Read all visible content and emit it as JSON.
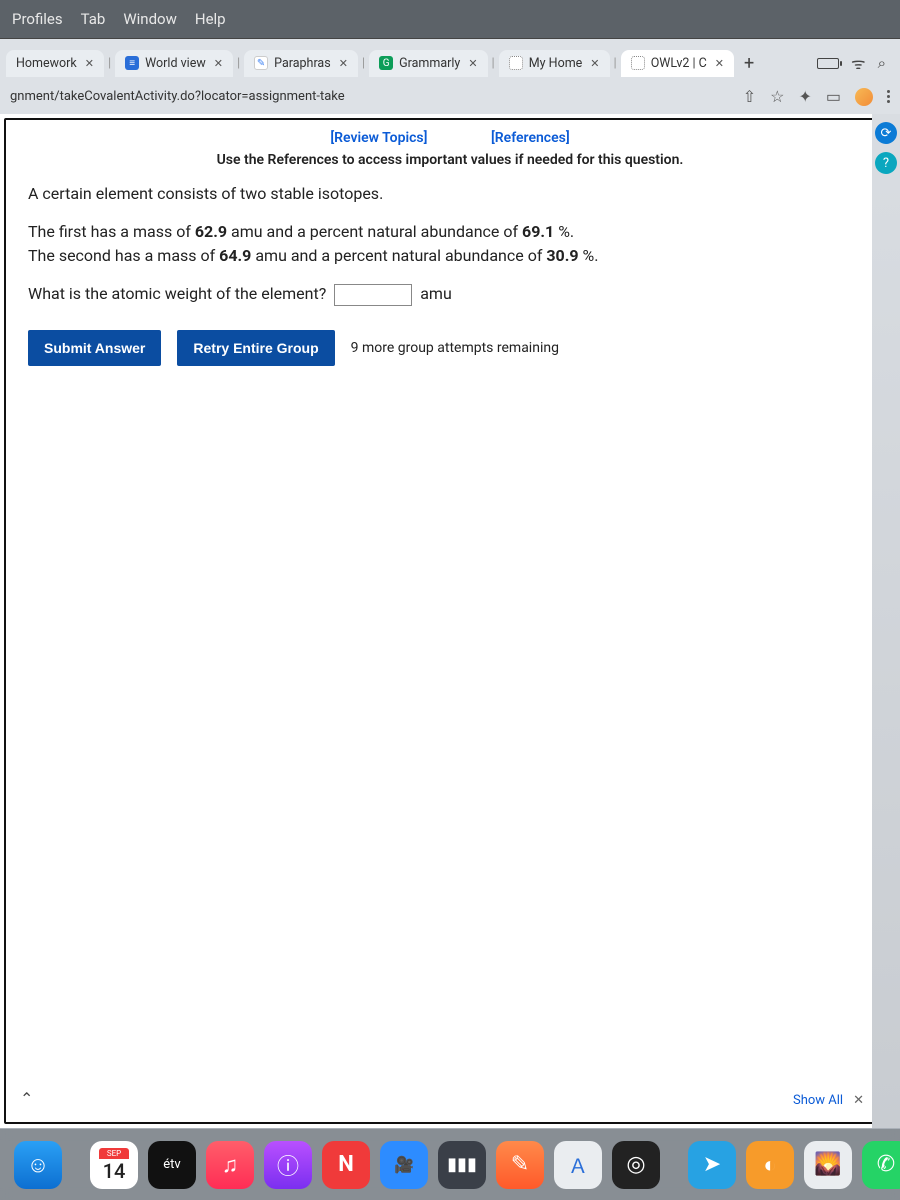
{
  "menubar": [
    "Profiles",
    "Tab",
    "Window",
    "Help"
  ],
  "tabs": [
    {
      "label": "Homework",
      "fav": "fav-white"
    },
    {
      "label": "World view",
      "fav": "fav-blue"
    },
    {
      "label": "Paraphras",
      "fav": "fav-white"
    },
    {
      "label": "Grammarly",
      "fav": "fav-green"
    },
    {
      "label": "My Home",
      "fav": "fav-dotted"
    },
    {
      "label": "OWLv2 | C",
      "fav": "fav-dotted",
      "active": true
    }
  ],
  "new_tab": "+",
  "url": "gnment/takeCovalentActivity.do?locator=assignment-take",
  "toplinks": {
    "review": "[Review Topics]",
    "references": "[References]"
  },
  "instruction": "Use the References to access important values if needed for this question.",
  "question": {
    "intro": "A certain element consists of two stable isotopes.",
    "line1a": "The first has a mass of ",
    "mass1": "62.9",
    "line1b": " amu and a percent natural abundance of ",
    "abund1": "69.1",
    "line1c": " %.",
    "line2a": "The second has a mass of ",
    "mass2": "64.9",
    "line2b": " amu and a percent natural abundance of ",
    "abund2": "30.9",
    "line2c": " %.",
    "prompt": "What is the atomic weight of the element?",
    "unit": "amu"
  },
  "buttons": {
    "submit": "Submit Answer",
    "retry": "Retry Entire Group"
  },
  "attempts": "9 more group attempts remaining",
  "show_all": "Show All",
  "calendar": {
    "month": "SEP",
    "day": "14"
  },
  "tv_label": "étv"
}
